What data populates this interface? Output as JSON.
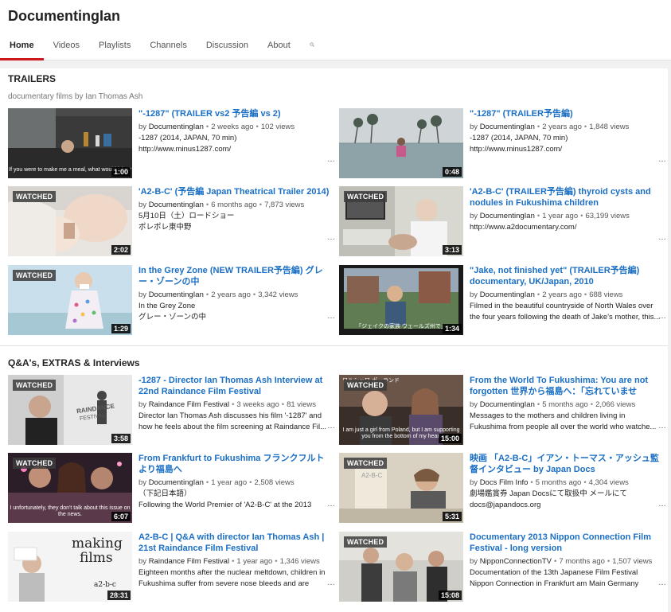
{
  "header": {
    "channel_title": "DocumentingIan",
    "tabs": [
      "Home",
      "Videos",
      "Playlists",
      "Channels",
      "Discussion",
      "About"
    ],
    "active_tab": "Home"
  },
  "sections": [
    {
      "title": "TRAILERS",
      "subtitle": "documentary films by Ian Thomas Ash",
      "videos": [
        {
          "title": "\"-1287\" (TRAILER vs2 予告編 vs 2)",
          "by": "DocumentingIan",
          "age": "2 weeks ago",
          "views": "102 views",
          "desc1": "-1287 (2014, JAPAN, 70 min)",
          "desc2": "http://www.minus1287.com/",
          "duration": "1:00",
          "watched": "",
          "caption": "If you were to make me a meal, what would it be?"
        },
        {
          "title": "\"-1287\" (TRAILER予告編)",
          "by": "DocumentingIan",
          "age": "2 years ago",
          "views": "1,848 views",
          "desc1": "-1287 (2014, JAPAN, 70 min)",
          "desc2": "http://www.minus1287.com/",
          "duration": "0:48",
          "watched": "",
          "caption": ""
        },
        {
          "title": "'A2-B-C' (予告編 Japan Theatrical Trailer 2014)",
          "by": "DocumentingIan",
          "age": "6 months ago",
          "views": "7,873 views",
          "desc1": "5月10日（土）ロードショー",
          "desc2": "ポレポレ東中野",
          "duration": "2:02",
          "watched": "WATCHED",
          "caption": ""
        },
        {
          "title": "'A2-B-C' (TRAILER予告編) thyroid cysts and nodules in Fukushima children",
          "by": "DocumentingIan",
          "age": "1 year ago",
          "views": "63,199 views",
          "desc1": "http://www.a2documentary.com/",
          "desc2": "",
          "duration": "3:13",
          "watched": "WATCHED",
          "caption": ""
        },
        {
          "title": "In the Grey Zone (NEW TRAILER予告編) グレー・ゾーンの中",
          "by": "DocumentingIan",
          "age": "2 years ago",
          "views": "3,342 views",
          "desc1": "In the Grey Zone",
          "desc2": "グレー・ゾーンの中",
          "duration": "1:29",
          "watched": "WATCHED",
          "caption": ""
        },
        {
          "title": "\"Jake, not finished yet\" (TRAILER予告編) documentary, UK/Japan, 2010",
          "by": "DocumentingIan",
          "age": "2 years ago",
          "views": "688 views",
          "desc1": "Filmed in the beautiful countryside of North Wales over",
          "desc2": "the four years following the death of Jake's mother, this...",
          "duration": "1:34",
          "watched": "",
          "caption": "「ジェイクの家族 ウェールズ州で」"
        }
      ]
    },
    {
      "title": "Q&A's, EXTRAS & Interviews",
      "subtitle": "",
      "videos": [
        {
          "title": "-1287 - Director Ian Thomas Ash Interview at 22nd Raindance Film Festival",
          "by": "Raindance Film Festival",
          "age": "3 weeks ago",
          "views": "81 views",
          "desc1": "Director Ian Thomas Ash discusses his film '-1287' and",
          "desc2": "how he feels about the film screening at Raindance Fil...",
          "duration": "3:58",
          "watched": "WATCHED",
          "caption": ""
        },
        {
          "title": "From the World To Fukushima: You are not forgotten 世界から福島へ：「忘れていませ",
          "by": "DocumentingIan",
          "age": "5 months ago",
          "views": "2,066 views",
          "desc1": "Messages to the mothers and children living in",
          "desc2": "Fukushima from people all over the world who watche...",
          "duration": "15:00",
          "watched": "WATCHED",
          "caption": "I am just a girl from Poland, but I am supporting you from the bottom of my heart"
        },
        {
          "title": "From Frankfurt to Fukushima フランクフルトより福島へ",
          "by": "DocumentingIan",
          "age": "1 year ago",
          "views": "2,508 views",
          "desc1": "（下記日本語）",
          "desc2": "Following the World Premier of 'A2-B-C' at the 2013",
          "duration": "6:07",
          "watched": "WATCHED",
          "caption": "I unfortunately, they don't talk about this issue on the news."
        },
        {
          "title": "映画 「A2-B-C」イアン・トーマス・アッシュ監督インタビュー by Japan Docs",
          "by": "Docs Film Info",
          "age": "5 months ago",
          "views": "4,304 views",
          "desc1": "劇場鑑賞券 Japan Docsにて取扱中 メールにて",
          "desc2": "docs@japandocs.org",
          "duration": "5:31",
          "watched": "WATCHED",
          "caption": ""
        },
        {
          "title": "A2-B-C | Q&A with director Ian Thomas Ash | 21st Raindance Film Festival",
          "by": "Raindance Film Festival",
          "age": "1 year ago",
          "views": "1,346 views",
          "desc1": "Eighteen months after the nuclear meltdown, children in",
          "desc2": "Fukushima suffer from severe nose bleeds and are",
          "duration": "28:31",
          "watched": "",
          "caption": ""
        },
        {
          "title": "Documentary 2013 Nippon Connection Film Festival - long version",
          "by": "NipponConnectionTV",
          "age": "7 months ago",
          "views": "1,507 views",
          "desc1": "Documentation of the 13th Japanese Film Festival",
          "desc2": "Nippon Connection in Frankfurt am Main Germany",
          "duration": "15:08",
          "watched": "WATCHED",
          "caption": ""
        }
      ]
    }
  ],
  "thumb_text": {
    "raindance": "RAINDANCE",
    "festival": "FESTIVAL",
    "making": "making",
    "films": "films",
    "a2bc": "a2-b-c",
    "a2bc_sign": "A2-B-C",
    "poland_label": "ワルシャワ ポーランド"
  },
  "colors": {
    "link": "#1b6fc4",
    "active_tab_underline": "#cc181e",
    "page_bg": "#ffffff",
    "strip_bg": "#f1f1f1"
  }
}
